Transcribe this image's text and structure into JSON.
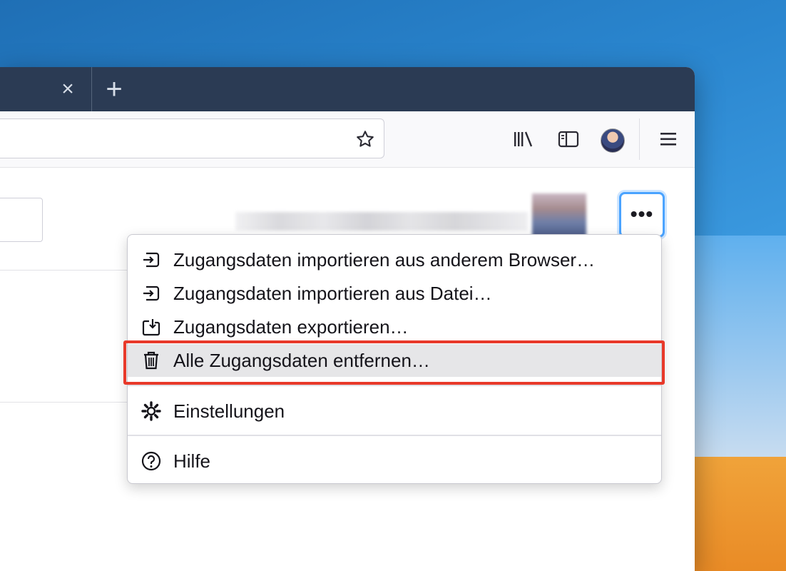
{
  "tabbar": {
    "tab_close_glyph": "×",
    "new_tab_glyph": "+"
  },
  "toolbar": {
    "bookmark_icon": "star-icon",
    "library_icon": "library-icon",
    "sidebar_icon": "sidebar-icon",
    "menu_icon": "hamburger-icon"
  },
  "page": {
    "more_button_label": "•••"
  },
  "menu": {
    "items": [
      {
        "label": "Zugangsdaten importieren aus anderem Browser…",
        "icon": "import-icon"
      },
      {
        "label": "Zugangsdaten importieren aus Datei…",
        "icon": "import-icon"
      },
      {
        "label": "Zugangsdaten exportieren…",
        "icon": "export-icon"
      },
      {
        "label": "Alle Zugangsdaten entfernen…",
        "icon": "trash-icon"
      },
      {
        "label": "Einstellungen",
        "icon": "gear-icon"
      },
      {
        "label": "Hilfe",
        "icon": "help-icon"
      }
    ]
  },
  "colors": {
    "tabbar": "#2b3b54",
    "highlight": "#e8392a",
    "focus_ring": "#4aa3ff"
  }
}
